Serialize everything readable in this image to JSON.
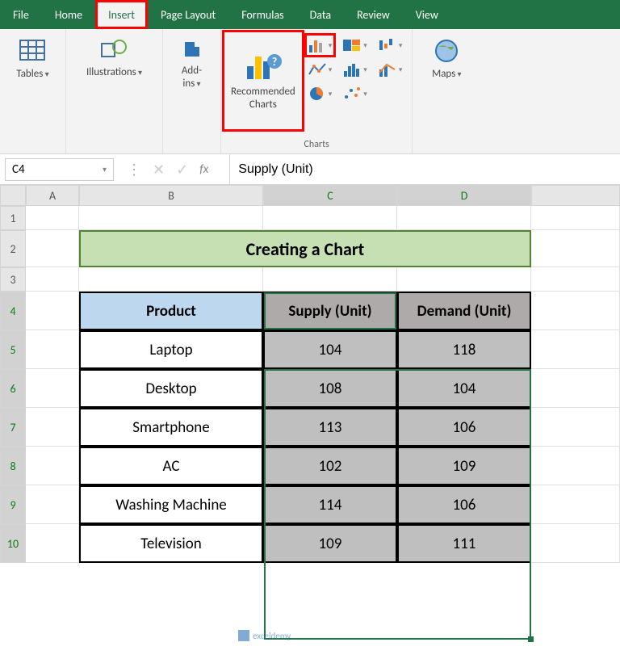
{
  "tabs": {
    "file": "File",
    "home": "Home",
    "insert": "Insert",
    "page_layout": "Page Layout",
    "formulas": "Formulas",
    "data": "Data",
    "review": "Review",
    "view": "View"
  },
  "ribbon": {
    "tables": "Tables",
    "illustrations": "Illustrations",
    "addins": "Add-\nins",
    "recommended_charts": "Recommended\nCharts",
    "charts_group": "Charts",
    "maps": "Maps"
  },
  "namebox": "C4",
  "formula_value": "Supply (Unit)",
  "columns": [
    "A",
    "B",
    "C",
    "D"
  ],
  "rows": [
    "1",
    "2",
    "3",
    "4",
    "5",
    "6",
    "7",
    "8",
    "9",
    "10"
  ],
  "sheet": {
    "title": "Creating a Chart",
    "headers": {
      "product": "Product",
      "supply": "Supply (Unit)",
      "demand": "Demand (Unit)"
    },
    "data": [
      {
        "product": "Laptop",
        "supply": 104,
        "demand": 118
      },
      {
        "product": "Desktop",
        "supply": 108,
        "demand": 104
      },
      {
        "product": "Smartphone",
        "supply": 113,
        "demand": 106
      },
      {
        "product": "AC",
        "supply": 102,
        "demand": 109
      },
      {
        "product": "Washing Machine",
        "supply": 114,
        "demand": 106
      },
      {
        "product": "Television",
        "supply": 109,
        "demand": 111
      }
    ]
  },
  "watermark": "exceldemy"
}
